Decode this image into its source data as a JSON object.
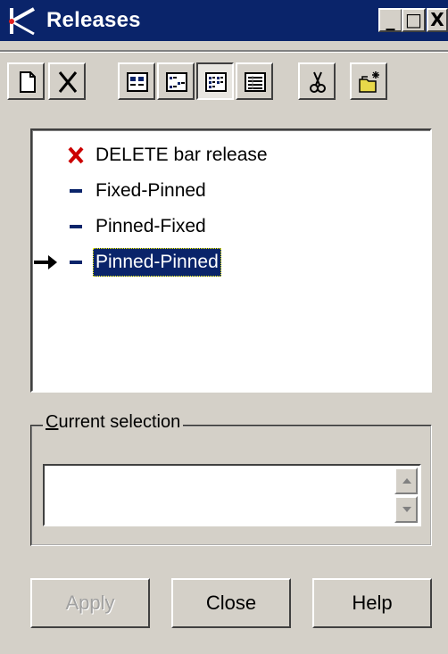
{
  "window": {
    "title": "Releases",
    "controls": {
      "minimize": "_",
      "maximize": "□",
      "close": "X"
    }
  },
  "toolbar": {
    "buttons": [
      {
        "name": "new-icon",
        "pressed": false
      },
      {
        "name": "delete-icon",
        "pressed": false
      },
      {
        "name": "view-large-icons-icon",
        "pressed": false
      },
      {
        "name": "view-small-icons-icon",
        "pressed": false
      },
      {
        "name": "view-list-icon",
        "pressed": true
      },
      {
        "name": "view-details-icon",
        "pressed": false
      },
      {
        "name": "cut-icon",
        "pressed": false
      },
      {
        "name": "new-folder-icon",
        "pressed": false
      }
    ]
  },
  "releases": {
    "items": [
      {
        "label": "DELETE bar release",
        "icon": "red-x-icon",
        "selected": false
      },
      {
        "label": "Fixed-Pinned",
        "icon": "dash-icon",
        "selected": false
      },
      {
        "label": "Pinned-Fixed",
        "icon": "dash-icon",
        "selected": false
      },
      {
        "label": "Pinned-Pinned",
        "icon": "dash-icon",
        "selected": true
      }
    ]
  },
  "current_selection": {
    "legend_prefix": "C",
    "legend_rest": "urrent selection",
    "value": ""
  },
  "buttons": {
    "apply": "Apply",
    "close": "Close",
    "help": "Help"
  },
  "colors": {
    "titlebar": "#0a246a",
    "face": "#d4d0c8",
    "selection": "#0a246a",
    "delete_icon": "#cc0000",
    "dash_icon": "#0a246a"
  }
}
